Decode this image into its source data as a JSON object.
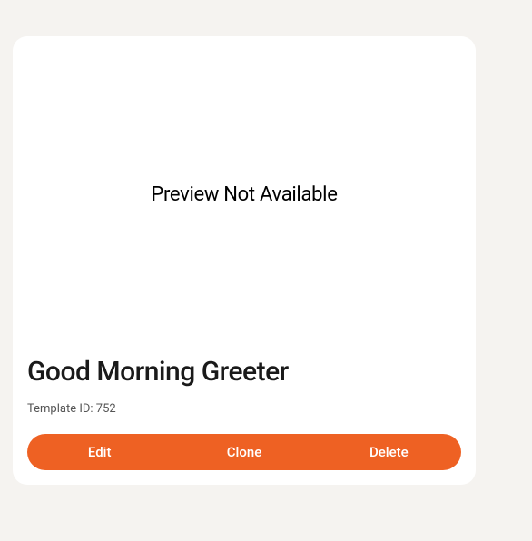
{
  "card": {
    "preview_text": "Preview Not Available",
    "title": "Good Morning Greeter",
    "template_id_label": "Template ID: 752",
    "actions": {
      "edit": "Edit",
      "clone": "Clone",
      "delete": "Delete"
    }
  }
}
